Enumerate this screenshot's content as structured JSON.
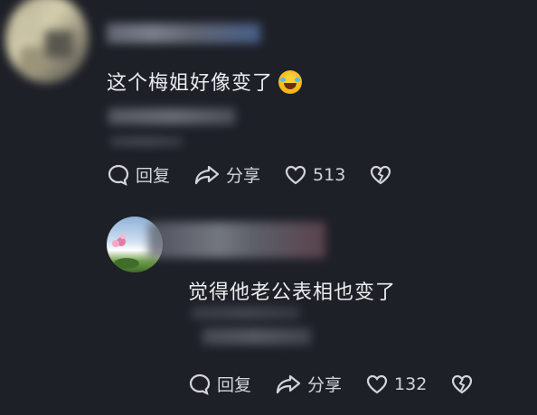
{
  "comments": [
    {
      "text": "这个梅姐好像变了",
      "emoji": "rofl-emoji",
      "actions": {
        "reply": "回复",
        "share": "分享",
        "likes": "513"
      }
    },
    {
      "text": "觉得他老公表相也变了",
      "actions": {
        "reply": "回复",
        "share": "分享",
        "likes": "132"
      }
    }
  ],
  "colors": {
    "background": "#1e2028",
    "text": "#ececee",
    "action": "#d4d5da"
  }
}
